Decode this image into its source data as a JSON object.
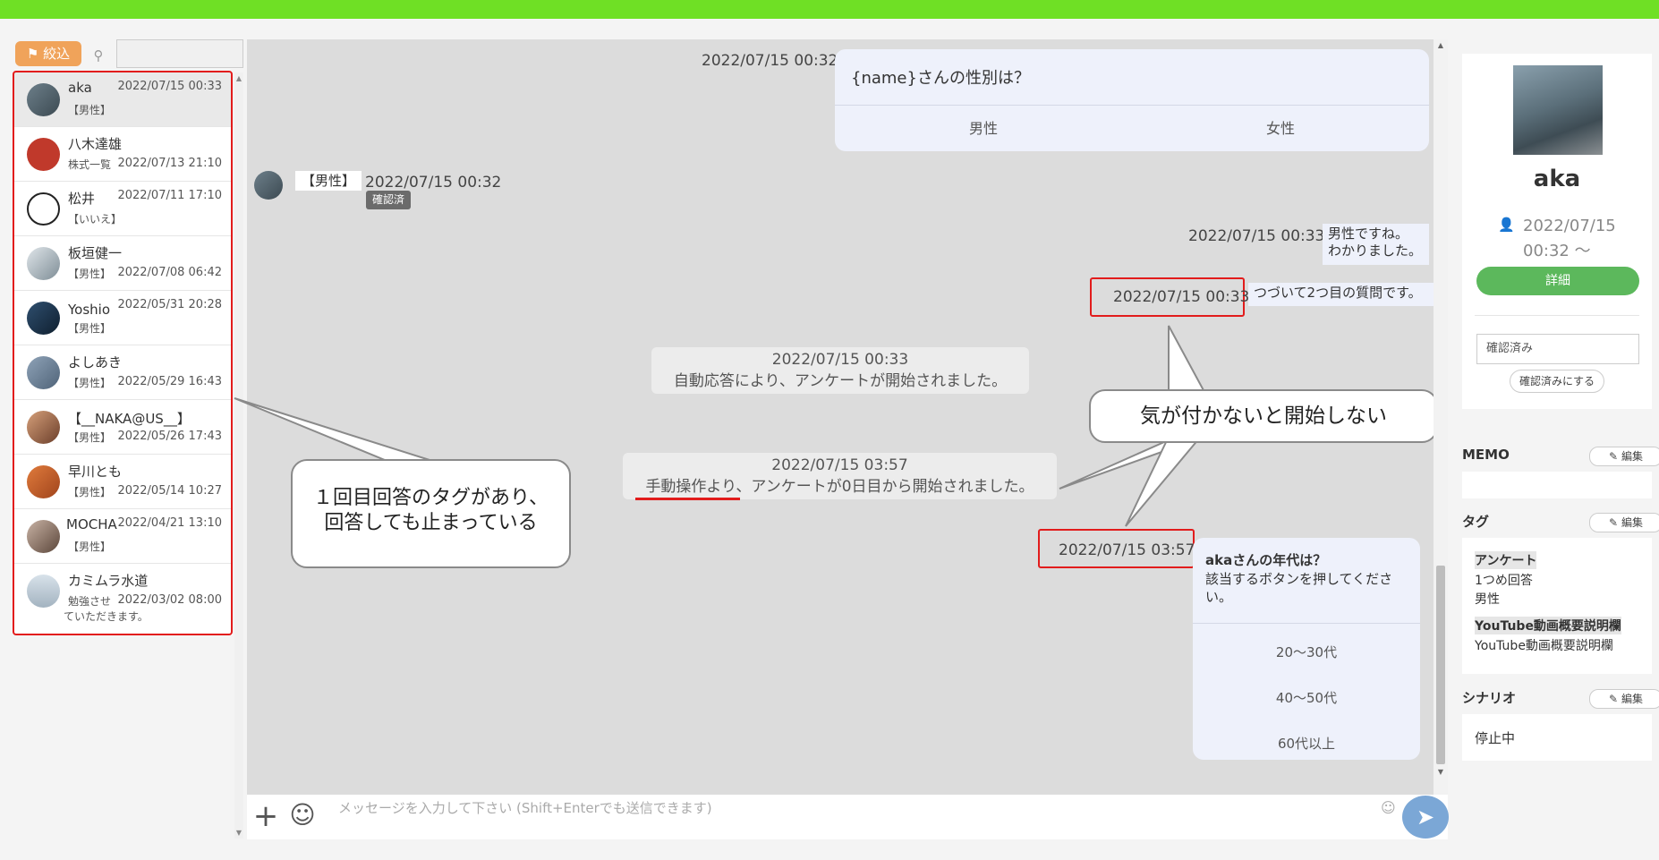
{
  "colors": {
    "topbar": "#6fe025",
    "accent_green": "#5cb85c",
    "filter_orange": "#f0a35a",
    "annotation_red": "#e21c1c",
    "send_blue": "#7ba7d6"
  },
  "sidebar": {
    "filter_label": "絞込",
    "friends": [
      {
        "name": "aka",
        "date": "2022/07/15 00:33",
        "tag": "【男性】"
      },
      {
        "name": "八木達雄",
        "date": "2022/07/13 21:10",
        "tag": "株式一覧"
      },
      {
        "name": "松井",
        "date": "2022/07/11 17:10",
        "tag": "【いいえ】"
      },
      {
        "name": "板垣健一",
        "date": "2022/07/08 06:42",
        "tag": "【男性】"
      },
      {
        "name": "Yoshio",
        "date": "2022/05/31 20:28",
        "tag": "【男性】"
      },
      {
        "name": "よしあき",
        "date": "2022/05/29 16:43",
        "tag": "【男性】"
      },
      {
        "name": "【__NAKA@US__】",
        "date": "2022/05/26 17:43",
        "tag": "【男性】"
      },
      {
        "name": "早川とも",
        "date": "2022/05/14 10:27",
        "tag": "【男性】"
      },
      {
        "name": "MOCHA",
        "date": "2022/04/21 13:10",
        "tag": "【男性】"
      },
      {
        "name": "カミムラ水道",
        "date": "2022/03/02 08:00",
        "tag": "勉強させ",
        "tag2": "ていただきます。"
      }
    ]
  },
  "chat": {
    "q1": {
      "timestamp": "2022/07/15 00:32",
      "question": "{name}さんの性別は？",
      "option_a": "男性",
      "option_b": "女性"
    },
    "user_reply": {
      "text": "【男性】",
      "timestamp": "2022/07/15 00:32",
      "read_badge": "確認済"
    },
    "bot_reply": {
      "timestamp": "2022/07/15 00:33",
      "line1": "男性ですね。",
      "line2": "わかりました。"
    },
    "bot_reply2": {
      "timestamp": "2022/07/15 00:33",
      "text": "つづいて2つ目の質問です。"
    },
    "sys1": {
      "timestamp": "2022/07/15 00:33",
      "text": "自動応答により、アンケートが開始されました。"
    },
    "sys2": {
      "timestamp": "2022/07/15 03:57",
      "text": "手動操作より、アンケートが0日目から開始されました。"
    },
    "q2": {
      "timestamp": "2022/07/15 03:57",
      "title": "akaさんの年代は？",
      "body1": "該当するボタンを押してくださ",
      "body2": "い。",
      "options": [
        "20～30代",
        "40～50代",
        "60代以上"
      ]
    },
    "input_placeholder": "メッセージを入力して下さい (Shift+Enterでも送信できます)"
  },
  "annotations": {
    "callout_left_line1": "１回目回答のタグがあり、",
    "callout_left_line2": "回答しても止まっている",
    "callout_right": "気が付かないと開始しない"
  },
  "profile": {
    "name": "aka",
    "since_line1": "2022/07/15",
    "since_line2": "00:32 ～",
    "detail_button": "詳細",
    "status_value": "確認済み",
    "mark_confirmed_button": "確認済みにする",
    "memo_label": "MEMO",
    "edit_label": "編集",
    "tag_label": "タグ",
    "tag_groups": [
      {
        "group": "アンケート",
        "items": [
          "1つめ回答",
          "男性"
        ]
      },
      {
        "group": "YouTube動画概要説明欄",
        "items": [
          "YouTube動画概要説明欄"
        ]
      }
    ],
    "scenario_label": "シナリオ",
    "scenario_value": "停止中"
  }
}
